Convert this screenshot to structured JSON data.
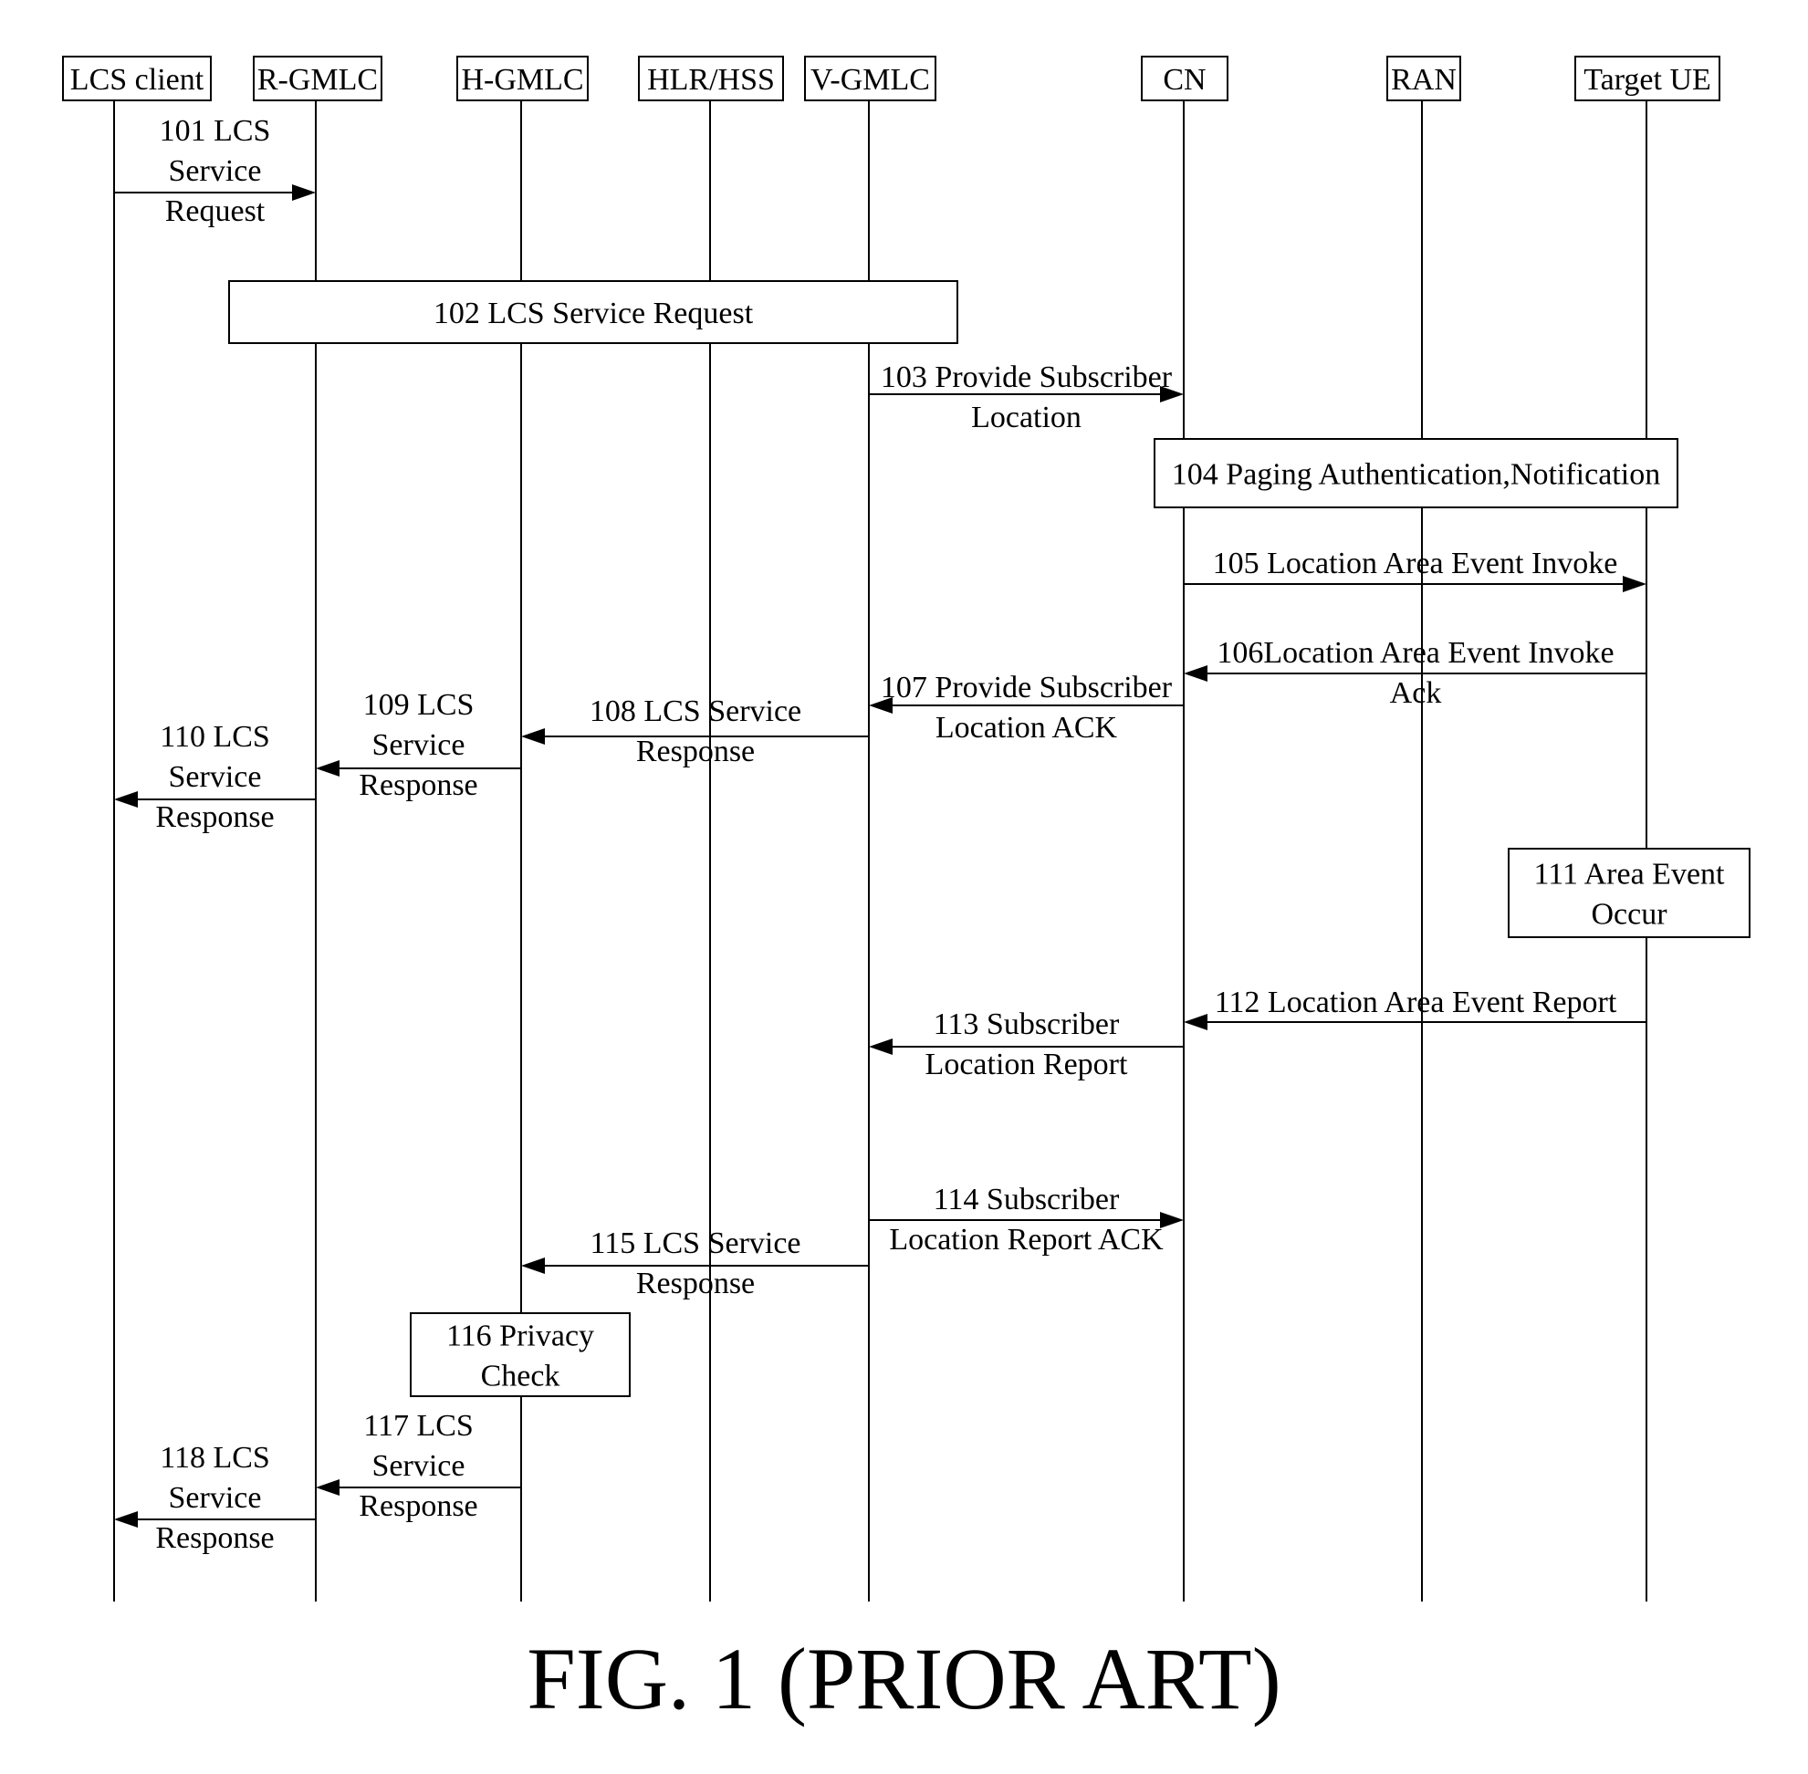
{
  "figure": {
    "title": "FIG.  1 (PRIOR ART)"
  },
  "participants": [
    {
      "id": "lcs_client",
      "label": "LCS client"
    },
    {
      "id": "r_gmlc",
      "label": "R-GMLC"
    },
    {
      "id": "h_gmlc",
      "label": "H-GMLC"
    },
    {
      "id": "hlr_hss",
      "label": "HLR/HSS"
    },
    {
      "id": "v_gmlc",
      "label": "V-GMLC"
    },
    {
      "id": "cn",
      "label": "CN"
    },
    {
      "id": "ran",
      "label": "RAN"
    },
    {
      "id": "target_ue",
      "label": "Target UE"
    }
  ],
  "steps": [
    {
      "id": "101",
      "kind": "message",
      "from": "lcs_client",
      "to": "r_gmlc",
      "lines": [
        "101 LCS",
        "Service",
        "Request"
      ]
    },
    {
      "id": "102",
      "kind": "box",
      "span": [
        "r_gmlc",
        "v_gmlc"
      ],
      "lines": [
        "102 LCS Service Request"
      ]
    },
    {
      "id": "103",
      "kind": "message",
      "from": "v_gmlc",
      "to": "cn",
      "lines": [
        "103 Provide Subscriber",
        "Location"
      ]
    },
    {
      "id": "104",
      "kind": "box",
      "span": [
        "cn",
        "target_ue"
      ],
      "lines": [
        "104 Paging Authentication,Notification"
      ]
    },
    {
      "id": "105",
      "kind": "message",
      "from": "cn",
      "to": "target_ue",
      "lines": [
        "105 Location Area Event Invoke"
      ]
    },
    {
      "id": "106",
      "kind": "message",
      "from": "target_ue",
      "to": "cn",
      "lines": [
        "106Location Area Event Invoke",
        "Ack"
      ]
    },
    {
      "id": "107",
      "kind": "message",
      "from": "cn",
      "to": "v_gmlc",
      "lines": [
        "107 Provide Subscriber",
        "Location ACK"
      ]
    },
    {
      "id": "108",
      "kind": "message",
      "from": "v_gmlc",
      "to": "h_gmlc",
      "lines": [
        "108 LCS Service",
        "Response"
      ]
    },
    {
      "id": "109",
      "kind": "message",
      "from": "h_gmlc",
      "to": "r_gmlc",
      "lines": [
        "109 LCS",
        "Service",
        "Response"
      ]
    },
    {
      "id": "110",
      "kind": "message",
      "from": "r_gmlc",
      "to": "lcs_client",
      "lines": [
        "110 LCS",
        "Service",
        "Response"
      ]
    },
    {
      "id": "111",
      "kind": "box",
      "span": [
        "target_ue"
      ],
      "lines": [
        "111 Area Event",
        "Occur"
      ]
    },
    {
      "id": "112",
      "kind": "message",
      "from": "target_ue",
      "to": "cn",
      "lines": [
        "112 Location Area Event Report"
      ]
    },
    {
      "id": "113",
      "kind": "message",
      "from": "cn",
      "to": "v_gmlc",
      "lines": [
        "113 Subscriber",
        "Location Report"
      ]
    },
    {
      "id": "114",
      "kind": "message",
      "from": "v_gmlc",
      "to": "cn",
      "lines": [
        "114 Subscriber",
        "Location Report ACK"
      ]
    },
    {
      "id": "115",
      "kind": "message",
      "from": "v_gmlc",
      "to": "h_gmlc",
      "lines": [
        "115 LCS Service",
        "Response"
      ]
    },
    {
      "id": "116",
      "kind": "box",
      "span": [
        "h_gmlc"
      ],
      "lines": [
        "116 Privacy",
        "Check"
      ]
    },
    {
      "id": "117",
      "kind": "message",
      "from": "h_gmlc",
      "to": "r_gmlc",
      "lines": [
        "117 LCS",
        "Service",
        "Response"
      ]
    },
    {
      "id": "118",
      "kind": "message",
      "from": "r_gmlc",
      "to": "lcs_client",
      "lines": [
        "118 LCS",
        "Service",
        "Response"
      ]
    }
  ]
}
